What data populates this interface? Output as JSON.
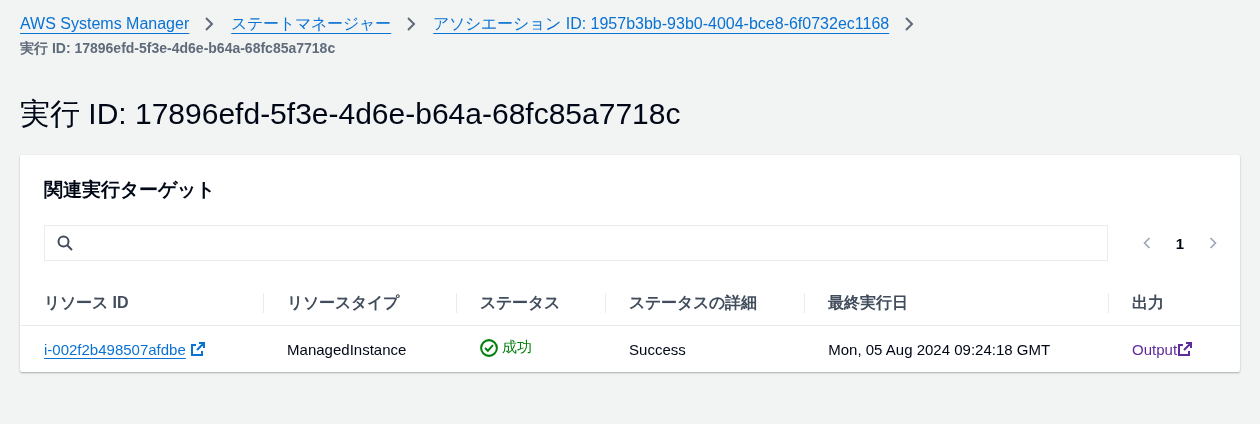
{
  "breadcrumbs": [
    {
      "label": "AWS Systems Manager"
    },
    {
      "label": "ステートマネージャー"
    },
    {
      "label": "アソシエーション ID: 1957b3bb-93b0-4004-bce8-6f0732ec1168"
    }
  ],
  "current_page": "実行 ID: 17896efd-5f3e-4d6e-b64a-68fc85a7718c",
  "page_title": "実行 ID: 17896efd-5f3e-4d6e-b64a-68fc85a7718c",
  "panel": {
    "title": "関連実行ターゲット",
    "pagination": {
      "pages": [
        {
          "label": "1",
          "selected": true
        }
      ],
      "previous_disabled": true,
      "next_disabled": true
    },
    "table": {
      "columns": [
        "リソース ID",
        "リソースタイプ",
        "ステータス",
        "ステータスの詳細",
        "最終実行日",
        "出力"
      ],
      "rows": [
        [
          {
            "kind": "link",
            "text": "i-002f2b498507afdbe",
            "visited": false
          },
          {
            "kind": "text",
            "text": "ManagedInstance"
          },
          {
            "kind": "status",
            "text": "成功",
            "color": "#037f0c"
          },
          {
            "kind": "text",
            "text": "Success"
          },
          {
            "kind": "text",
            "text": "Mon, 05 Aug 2024 09:24:18 GMT"
          },
          {
            "kind": "link",
            "text": "Output",
            "visited": true
          }
        ]
      ]
    }
  }
}
